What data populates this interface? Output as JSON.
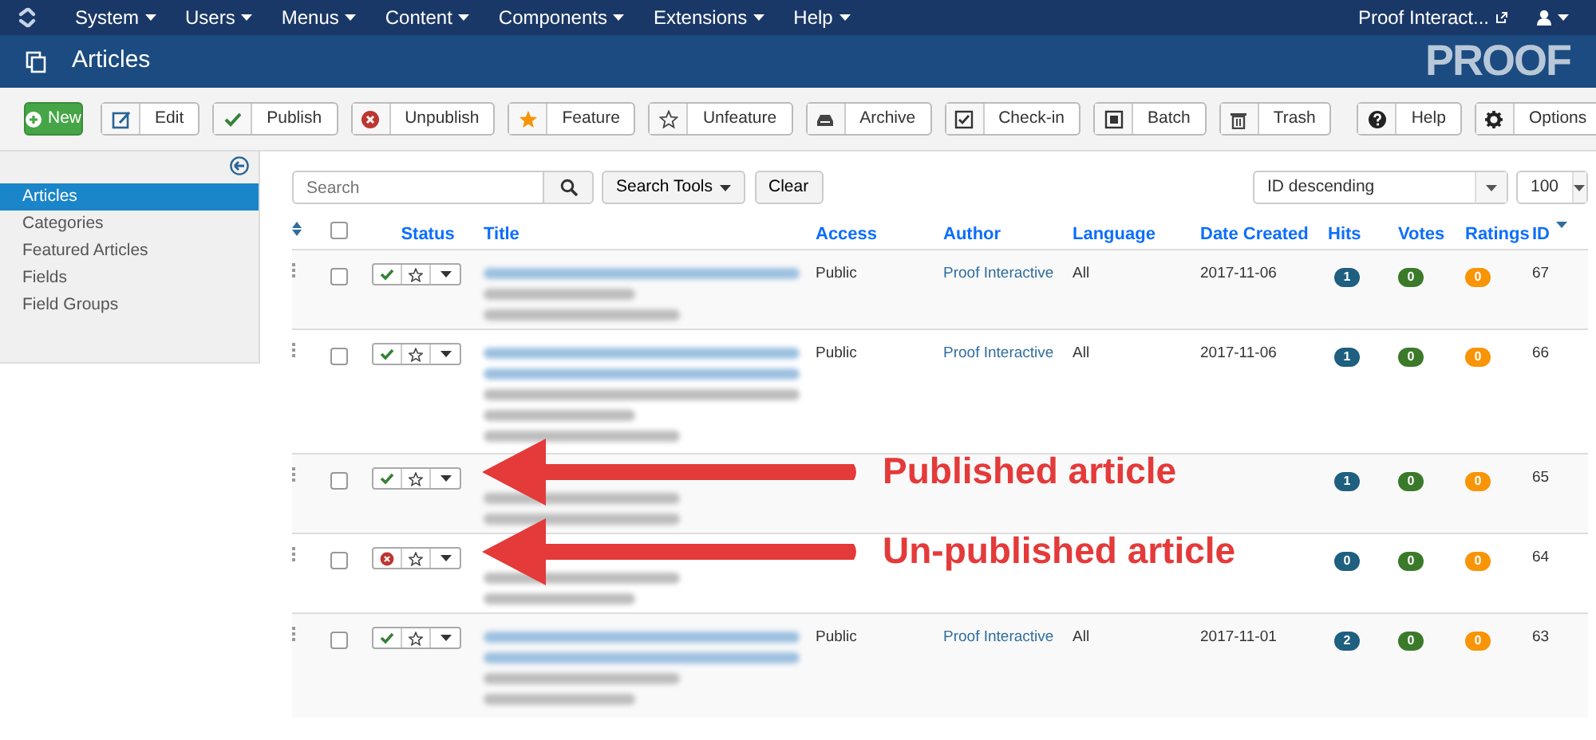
{
  "top_menu": {
    "items": [
      "System",
      "Users",
      "Menus",
      "Content",
      "Components",
      "Extensions",
      "Help"
    ],
    "site_link": "Proof Interact..."
  },
  "header": {
    "title": "Articles",
    "logo": "PROOF"
  },
  "toolbar": {
    "new": "New",
    "buttons": [
      "Edit",
      "Publish",
      "Unpublish",
      "Feature",
      "Unfeature",
      "Archive",
      "Check-in",
      "Batch",
      "Trash"
    ],
    "right_buttons": [
      "Help",
      "Options"
    ]
  },
  "sidebar": {
    "items": [
      {
        "label": "Articles",
        "selected": true
      },
      {
        "label": "Categories",
        "selected": false
      },
      {
        "label": "Featured Articles",
        "selected": false
      },
      {
        "label": "Fields",
        "selected": false
      },
      {
        "label": "Field Groups",
        "selected": false
      }
    ]
  },
  "filters": {
    "search": {
      "placeholder": "Search"
    },
    "search_tools": "Search Tools",
    "clear": "Clear",
    "ordering": "ID descending",
    "limit": "100"
  },
  "table": {
    "columns": [
      "Status",
      "Title",
      "Access",
      "Author",
      "Language",
      "Date Created",
      "Hits",
      "Votes",
      "Ratings",
      "ID"
    ],
    "all_checked": false,
    "rows": [
      {
        "checked": false,
        "published": true,
        "featured": false,
        "access": "Public",
        "author": "Proof Interactive",
        "language": "All",
        "date": "2017-11-06",
        "hits": "1",
        "votes": "0",
        "ratings": "0",
        "id": "67"
      },
      {
        "checked": false,
        "published": true,
        "featured": false,
        "access": "Public",
        "author": "Proof Interactive",
        "language": "All",
        "date": "2017-11-06",
        "hits": "1",
        "votes": "0",
        "ratings": "0",
        "id": "66"
      },
      {
        "checked": false,
        "published": true,
        "featured": false,
        "hits": "1",
        "votes": "0",
        "ratings": "0",
        "id": "65",
        "annotation": "Published article"
      },
      {
        "checked": false,
        "published": false,
        "featured": false,
        "hits": "0",
        "votes": "0",
        "ratings": "0",
        "id": "64",
        "annotation": "Un-published article"
      },
      {
        "checked": false,
        "published": true,
        "featured": false,
        "access": "Public",
        "author": "Proof Interactive",
        "language": "All",
        "date": "2017-11-01",
        "hits": "2",
        "votes": "0",
        "ratings": "0",
        "id": "63"
      }
    ]
  }
}
